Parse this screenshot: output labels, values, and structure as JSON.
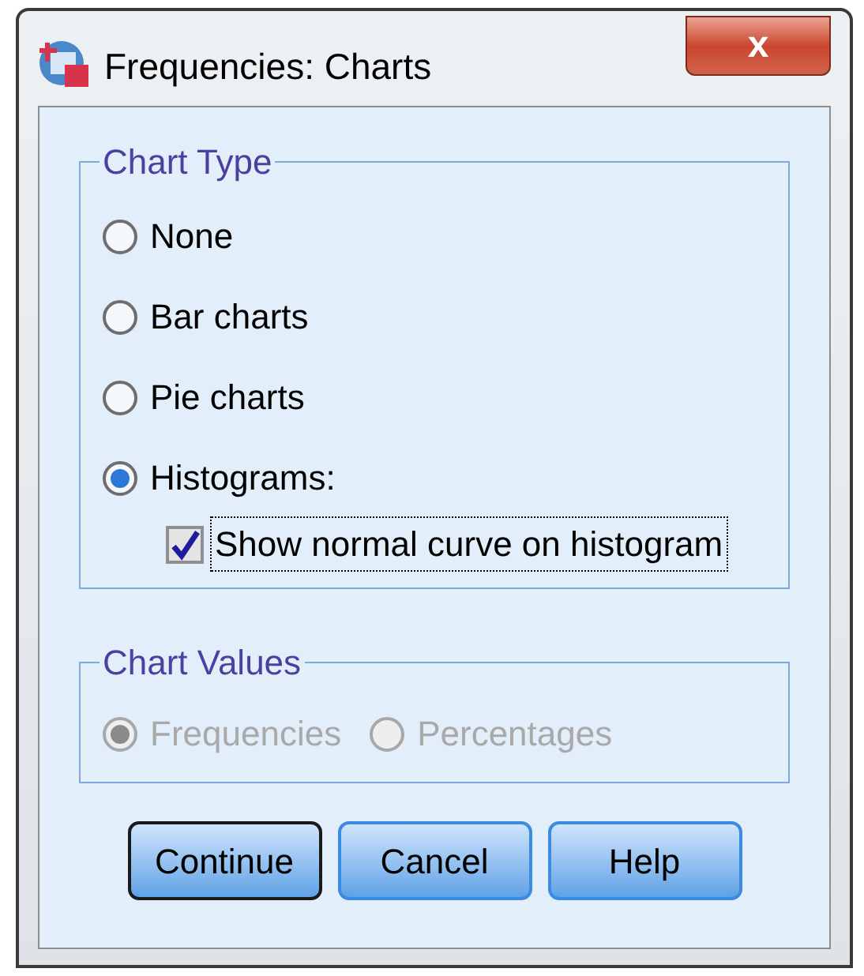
{
  "window": {
    "title": "Frequencies: Charts",
    "close_label": "x"
  },
  "chart_type": {
    "title": "Chart Type",
    "options": [
      {
        "label": "None",
        "selected": false
      },
      {
        "label": "Bar charts",
        "selected": false
      },
      {
        "label": "Pie charts",
        "selected": false
      },
      {
        "label": "Histograms:",
        "selected": true
      }
    ],
    "checkbox": {
      "label": "Show normal curve on histogram",
      "checked": true,
      "focused": true
    }
  },
  "chart_values": {
    "title": "Chart Values",
    "disabled": true,
    "options": [
      {
        "label": "Frequencies",
        "selected": true
      },
      {
        "label": "Percentages",
        "selected": false
      }
    ]
  },
  "buttons": [
    {
      "label": "Continue",
      "default": true
    },
    {
      "label": "Cancel",
      "default": false
    },
    {
      "label": "Help",
      "default": false
    }
  ]
}
